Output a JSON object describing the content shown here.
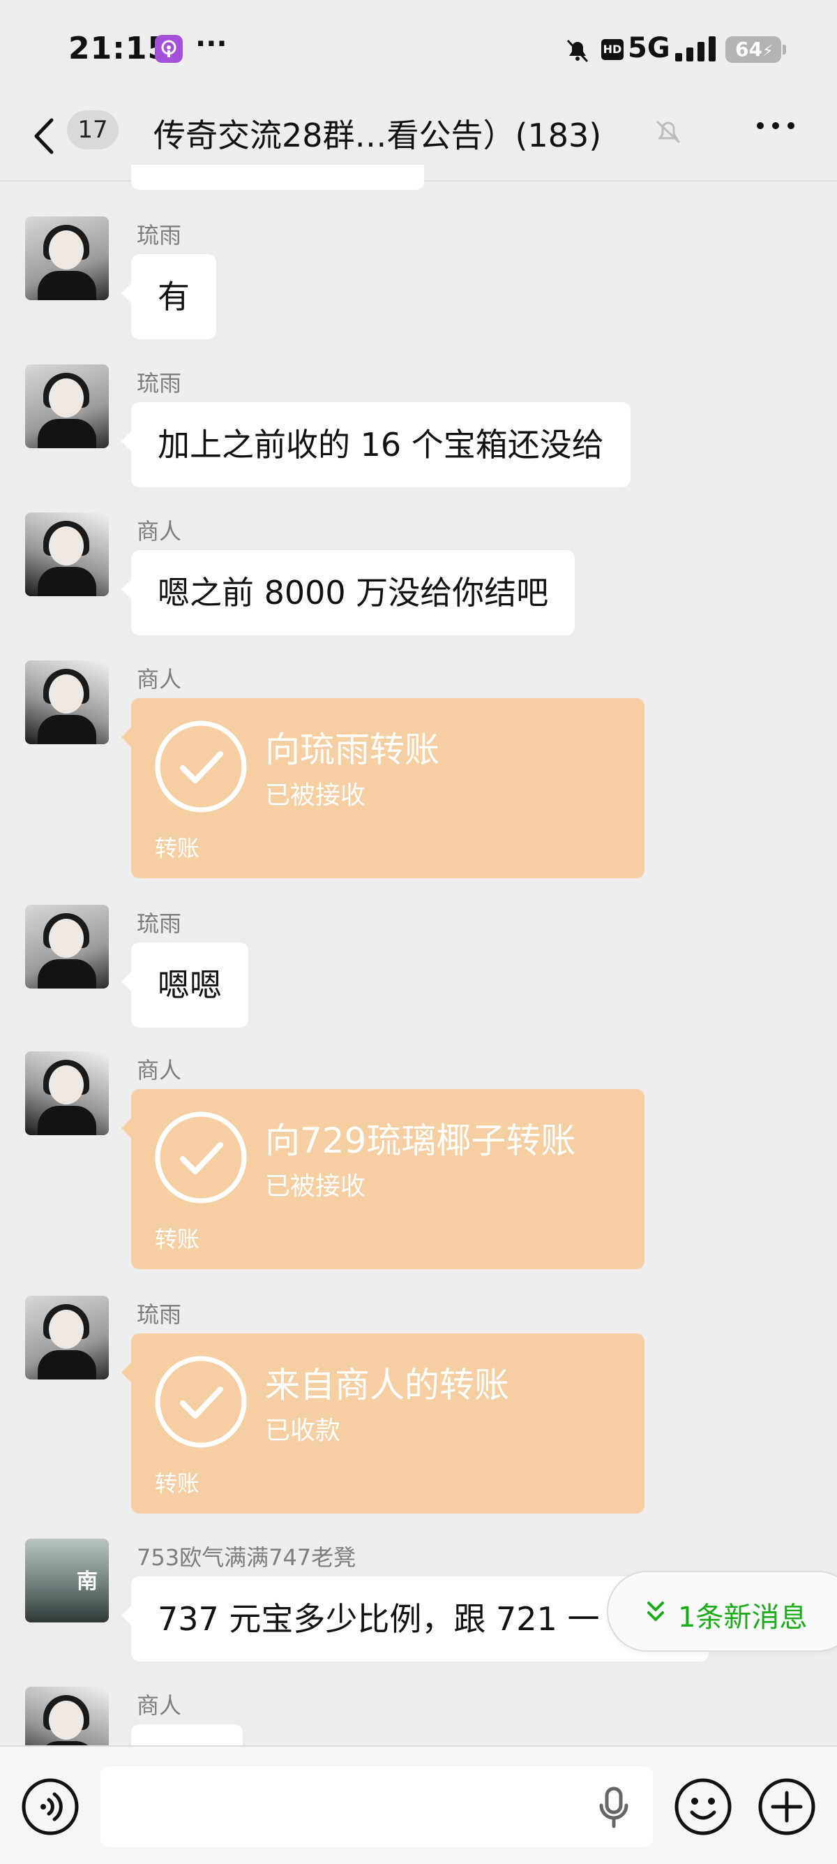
{
  "status_bar": {
    "time": "21:15",
    "more": "···",
    "hd": "HD",
    "network": "5G",
    "battery": "64"
  },
  "nav": {
    "unread_count": "17",
    "title": "传奇交流28群…看公告）(183)"
  },
  "messages": [
    {
      "sender": "琉雨",
      "type": "text",
      "text": "有"
    },
    {
      "sender": "琉雨",
      "type": "text",
      "text": "加上之前收的 16 个宝箱还没给"
    },
    {
      "sender": "商人",
      "type": "text",
      "text": "嗯之前 8000 万没给你结吧"
    },
    {
      "sender": "商人",
      "type": "transfer",
      "title": "向琉雨转账",
      "status": "已被接收",
      "label": "转账"
    },
    {
      "sender": "琉雨",
      "type": "text",
      "text": "嗯嗯"
    },
    {
      "sender": "商人",
      "type": "transfer",
      "title": "向729琉璃椰子转账",
      "status": "已被接收",
      "label": "转账"
    },
    {
      "sender": "琉雨",
      "type": "transfer",
      "title": "来自商人的转账",
      "status": "已收款",
      "label": "转账"
    },
    {
      "sender": "753欧气满满747老凳",
      "type": "text",
      "text": "737 元宝多少比例，跟 721 一",
      "avatar_char": "南"
    },
    {
      "sender": "商人",
      "type": "text",
      "text": ""
    }
  ],
  "new_messages_pill": "1条新消息",
  "input": {
    "value": "",
    "placeholder": ""
  },
  "colors": {
    "background": "#ededed",
    "transfer_bubble": "#f5cea2",
    "accent_green": "#1aad19"
  },
  "icons": [
    "back-icon",
    "podcast-icon",
    "mute-icon",
    "signal-icon",
    "bell-off-icon",
    "more-icon",
    "check-icon",
    "chevron-down-icon",
    "voice-icon",
    "mic-icon",
    "emoji-icon",
    "plus-icon"
  ]
}
